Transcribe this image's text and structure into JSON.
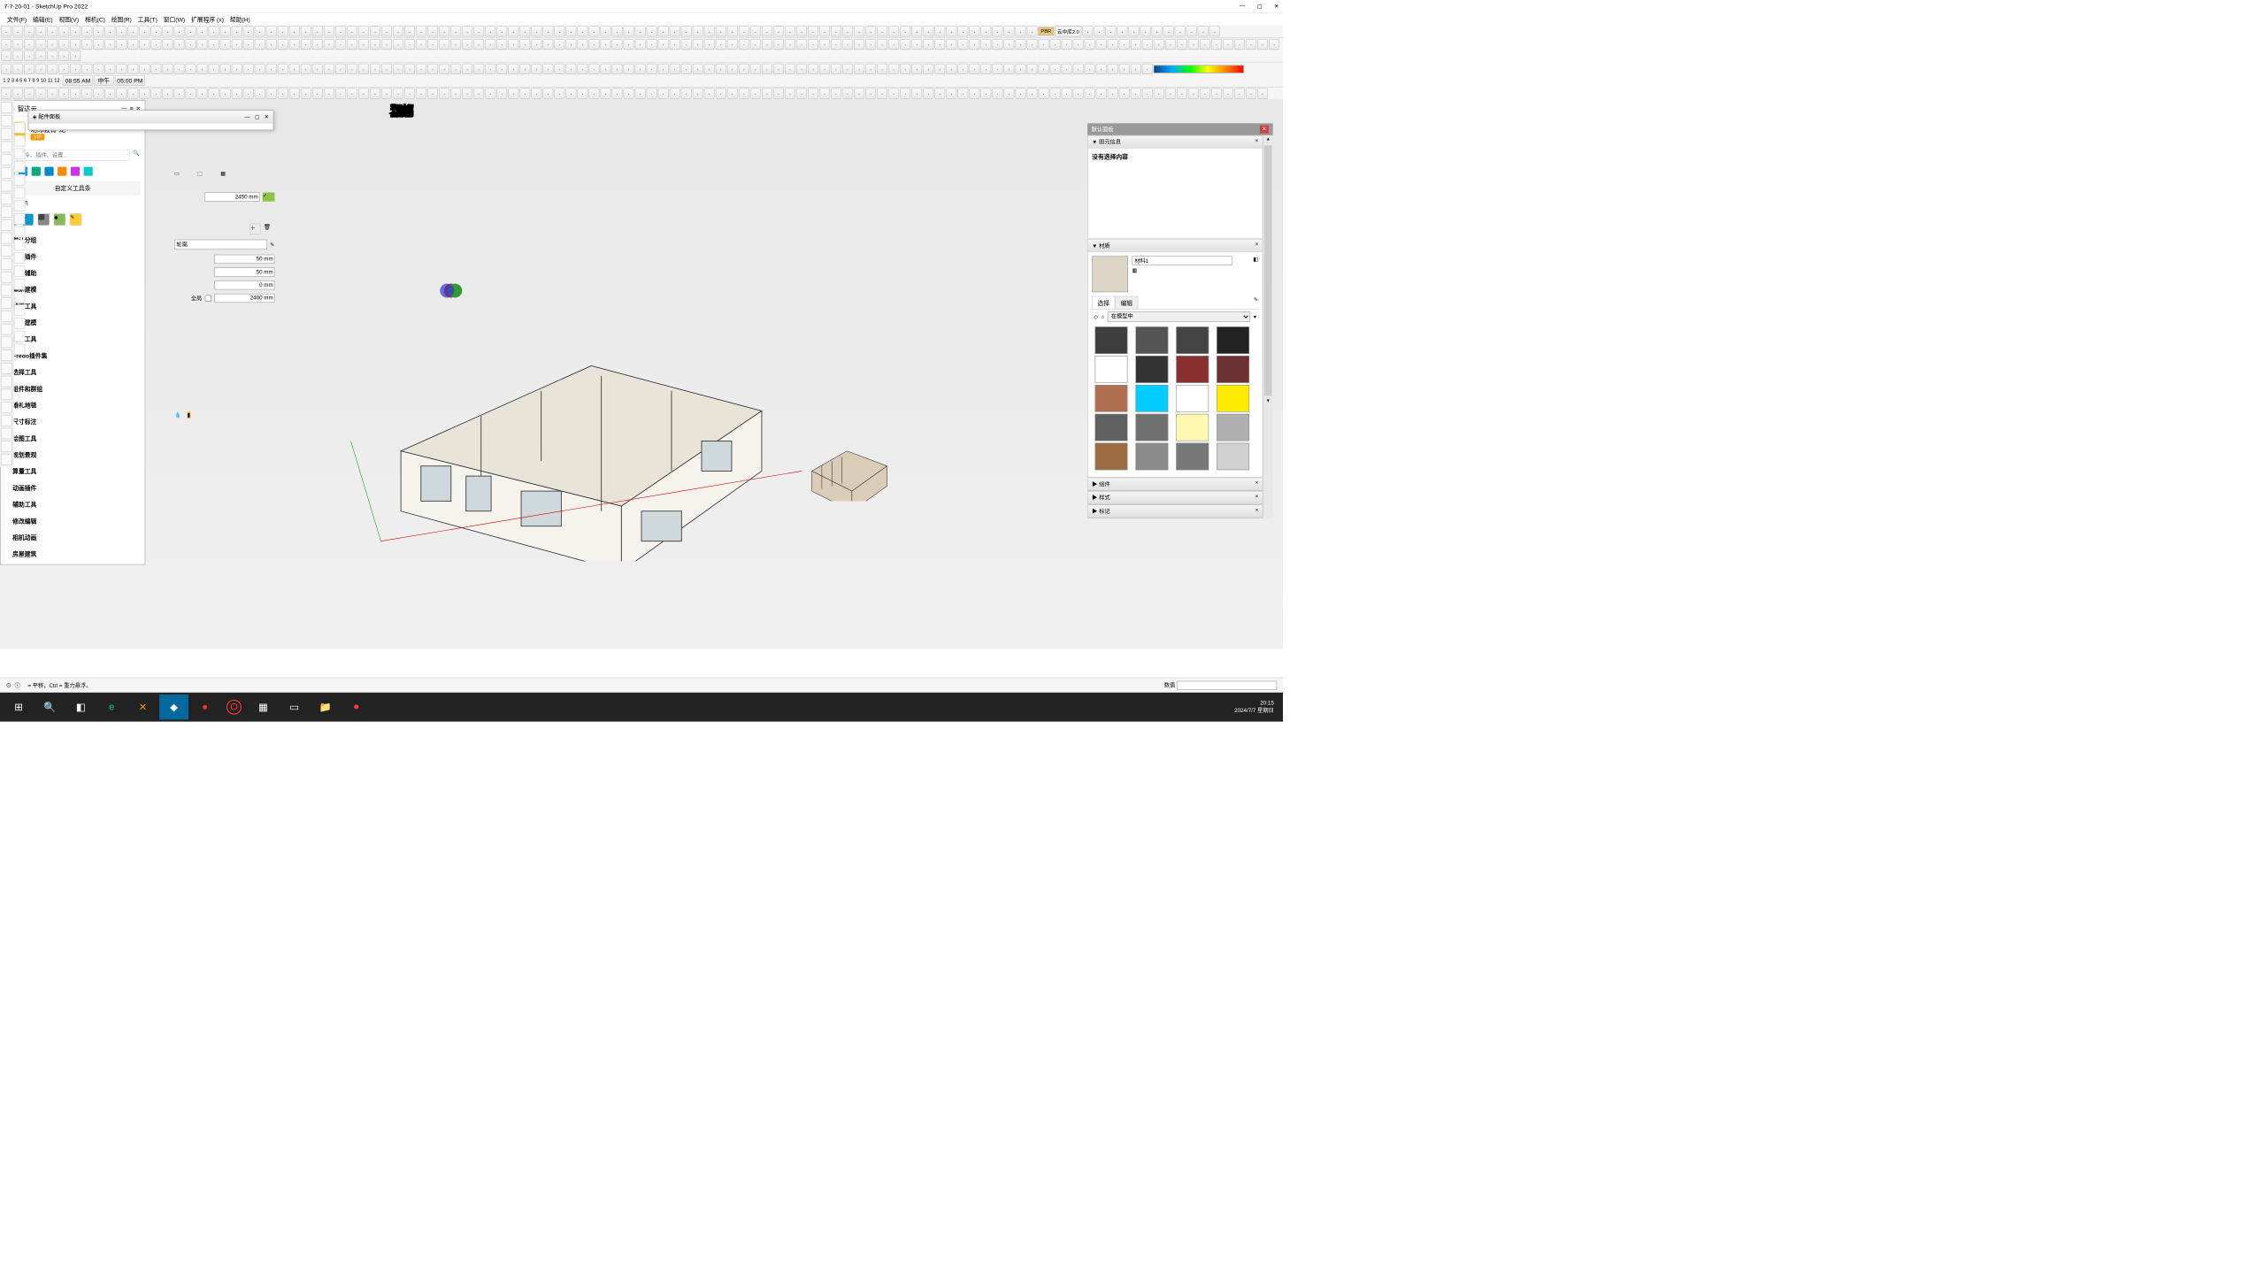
{
  "window": {
    "title": "7-7-20-01 - SketchUp Pro 2022"
  },
  "menu": [
    "文件(F)",
    "编辑(E)",
    "视图(V)",
    "相机(C)",
    "绘图(R)",
    "工具(T)",
    "窗口(W)",
    "扩展程序 (x)",
    "帮助(H)"
  ],
  "overlay": {
    "l1": "草图大师",
    "l2": "全屋定制"
  },
  "cloudPanel": {
    "title": "智达云",
    "user": "北纬教育-龙",
    "vip": "VIP",
    "searchPlaceholder": "搜索命令、插件、设置...",
    "customBar": "自定义工具条",
    "common": "常用工具",
    "items": [
      "默认分组",
      "门窗插件",
      "渲染辅助",
      "辅助建模",
      "线面工具",
      "曲面建模",
      "材质工具",
      "Fredo插件集",
      "选择工具",
      "组件和群组",
      "婚礼地毯",
      "尺寸标注",
      "绘图工具",
      "规划景观",
      "算量工具",
      "动画插件",
      "辅助工具",
      "修改编辑",
      "相机动画",
      "房屋建筑"
    ]
  },
  "componentPanel": {
    "title": "配件面板"
  },
  "valueInputs": {
    "v1": "2450 mm",
    "v2": "50 mm",
    "v3": "50 mm",
    "v4": "0 mm",
    "v5": "2400 mm",
    "globalLabel": "全局",
    "outlineLabel": "轮廓"
  },
  "tray": {
    "title": "默认面板",
    "entity": {
      "title": "图元信息",
      "content": "没有选择内容"
    },
    "material": {
      "title": "材质",
      "name": "材料1",
      "selectTab": "选择",
      "editTab": "编辑",
      "dropdown": "在模型中"
    },
    "component": {
      "title": "组件"
    },
    "style": {
      "title": "样式"
    },
    "mark": {
      "title": "标记"
    }
  },
  "swatches": [
    "#3e3e3e",
    "#555",
    "#444",
    "#222",
    "#fff",
    "#333",
    "#8b3030",
    "#6b3030",
    "#b07050",
    "#00ccff",
    "#ffffff",
    "#ffeb00",
    "#606060",
    "#707070",
    "#fff8b0",
    "#b0b0b0",
    "#9c6b42",
    "#8a8a8a",
    "#787878",
    "#d0d0d0"
  ],
  "statusbar": {
    "hint": "= 平移，Ctrl = 重力悬浮。",
    "value": "数值"
  },
  "taskbar": {
    "time": "20:15",
    "date": "2024/7/7 星期日"
  },
  "toolbarTimes": {
    "t1": "08:55 AM",
    "t2": "中午",
    "t3": "05:00 PM"
  }
}
